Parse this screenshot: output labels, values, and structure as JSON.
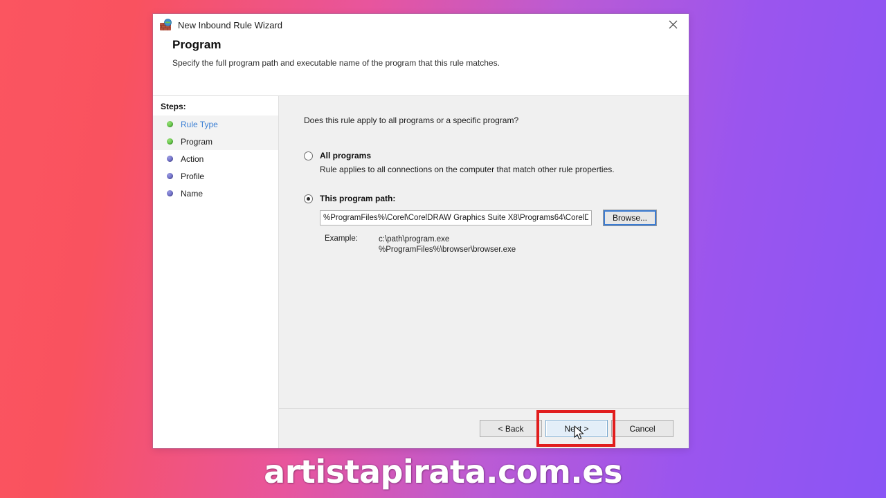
{
  "window": {
    "title": "New Inbound Rule Wizard",
    "icon": "firewall-shield-icon",
    "close_label": "✕"
  },
  "header": {
    "title": "Program",
    "subtitle": "Specify the full program path and executable name of the program that this rule matches."
  },
  "sidebar": {
    "label": "Steps:",
    "items": [
      {
        "label": "Rule Type",
        "state": "done",
        "style": "link",
        "highlight": true
      },
      {
        "label": "Program",
        "state": "done",
        "style": "current",
        "highlight": true
      },
      {
        "label": "Action",
        "state": "pending",
        "style": "normal",
        "highlight": false
      },
      {
        "label": "Profile",
        "state": "pending",
        "style": "normal",
        "highlight": false
      },
      {
        "label": "Name",
        "state": "pending",
        "style": "normal",
        "highlight": false
      }
    ]
  },
  "main": {
    "question": "Does this rule apply to all programs or a specific program?",
    "all_programs": {
      "label": "All programs",
      "description": "Rule applies to all connections on the computer that match other rule properties.",
      "selected": false
    },
    "this_program": {
      "label": "This program path:",
      "selected": true,
      "path_value": "%ProgramFiles%\\Corel\\CorelDRAW Graphics Suite X8\\Programs64\\CorelD",
      "path_placeholder": "",
      "browse_label": "Browse..."
    },
    "example": {
      "label": "Example:",
      "line1": "c:\\path\\program.exe",
      "line2": "%ProgramFiles%\\browser\\browser.exe"
    }
  },
  "footer": {
    "back_label": "< Back",
    "next_label": "Next >",
    "cancel_label": "Cancel",
    "next_highlight_color": "#e11d1d"
  },
  "overlay": {
    "flag": "spain-flag-watermark",
    "site_watermark": "artistapirata.com.es"
  },
  "colors": {
    "background_start": "#fb5560",
    "background_end": "#8a55f5",
    "link": "#3b7fd4",
    "step_done": "#64c648",
    "step_pending": "#6f6fc8",
    "annotation": "#e11d1d"
  }
}
